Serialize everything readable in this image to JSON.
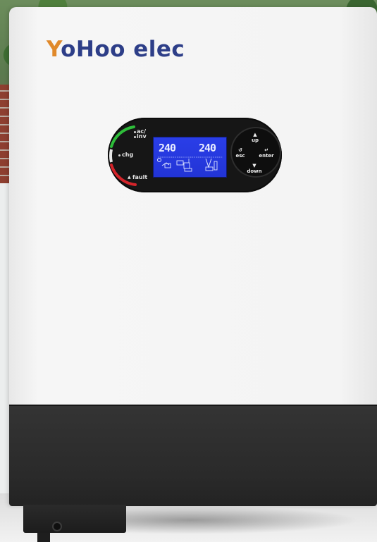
{
  "brand": {
    "mark": "Y",
    "name_rest": "oHoo elec",
    "colors": {
      "mark": "#e0892a",
      "text": "#2d3e88"
    }
  },
  "indicators": [
    {
      "label": "ac/",
      "color": "#2ebd3a"
    },
    {
      "label": "inv",
      "color": "#2ebd3a"
    },
    {
      "label": "chg",
      "color": "#d9d9d9"
    },
    {
      "label": "fault",
      "icon": "warning-triangle-icon",
      "color": "#d3242a"
    }
  ],
  "lcd": {
    "input_reading": "240",
    "output_reading": "240",
    "background_color": "#2634e0"
  },
  "keypad": {
    "up": "up",
    "down": "down",
    "esc": "esc",
    "enter": "enter"
  }
}
